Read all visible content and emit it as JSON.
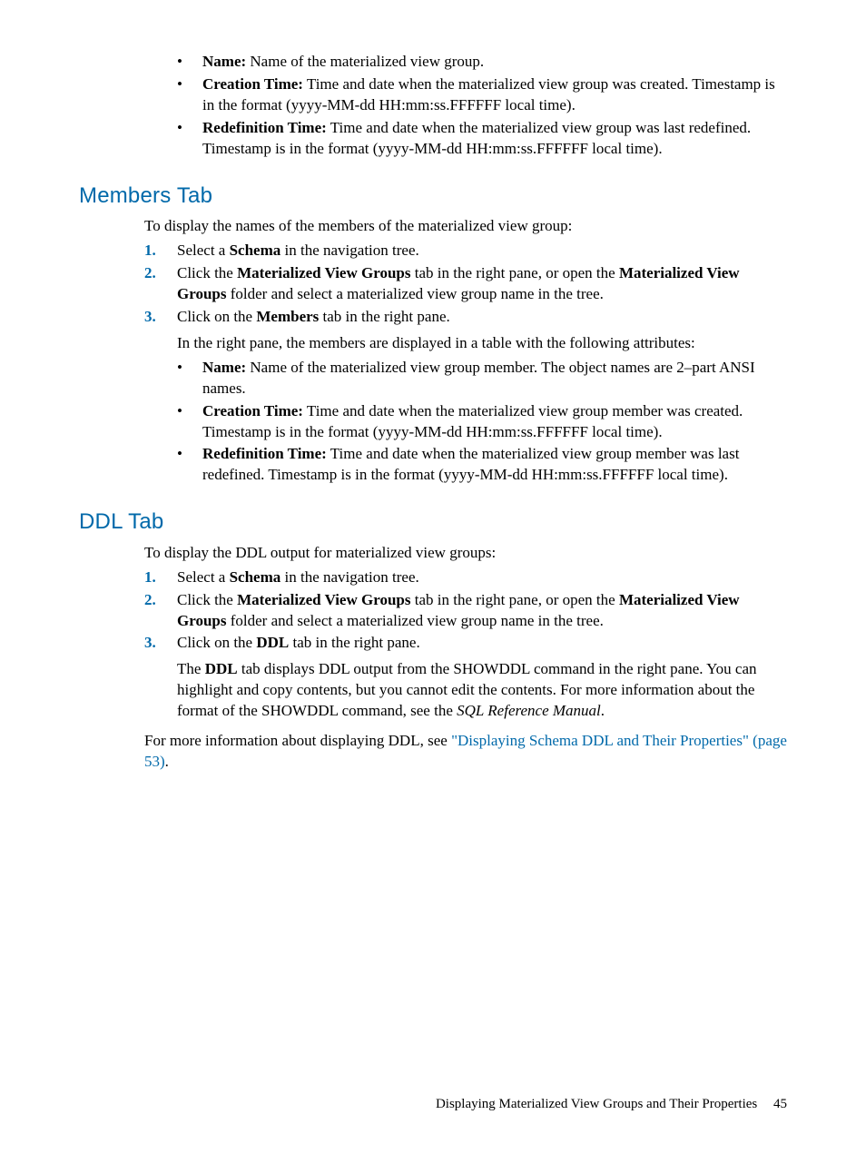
{
  "top_bullets": [
    {
      "label": "Name:",
      "text": " Name of the materialized view group."
    },
    {
      "label": "Creation Time:",
      "text": " Time and date when the materialized view group was created. Timestamp is in the format (yyyy-MM-dd HH:mm:ss.FFFFFF local time)."
    },
    {
      "label": "Redefinition Time:",
      "text": " Time and date when the materialized view group was last redefined. Timestamp is in the format (yyyy-MM-dd HH:mm:ss.FFFFFF local time)."
    }
  ],
  "members": {
    "heading": "Members Tab",
    "intro": "To display the names of the members of the materialized view group:",
    "step1_a": "Select a ",
    "step1_b": "Schema",
    "step1_c": " in the navigation tree.",
    "step2_a": "Click the ",
    "step2_b": "Materialized View Groups",
    "step2_c": " tab in the right pane, or open the ",
    "step2_d": "Materialized View Groups",
    "step2_e": " folder and select a materialized view group name in the tree.",
    "step3_a": "Click on the ",
    "step3_b": "Members",
    "step3_c": " tab in the right pane.",
    "step3_after": "In the right pane, the members are displayed in a table with the following attributes:",
    "bullets": [
      {
        "label": "Name:",
        "text": " Name of the materialized view group member. The object names are 2–part ANSI names."
      },
      {
        "label": "Creation Time:",
        "text": " Time and date when the materialized view group member was created. Timestamp is in the format (yyyy-MM-dd HH:mm:ss.FFFFFF local time)."
      },
      {
        "label": "Redefinition Time:",
        "text": " Time and date when the materialized view group member was last redefined. Timestamp is in the format (yyyy-MM-dd HH:mm:ss.FFFFFF local time)."
      }
    ]
  },
  "ddl": {
    "heading": "DDL Tab",
    "intro": "To display the DDL output for materialized view groups:",
    "step1_a": "Select a ",
    "step1_b": "Schema",
    "step1_c": " in the navigation tree.",
    "step2_a": "Click the ",
    "step2_b": "Materialized View Groups",
    "step2_c": " tab in the right pane, or open the ",
    "step2_d": "Materialized View Groups",
    "step2_e": " folder and select a materialized view group name in the tree.",
    "step3_a": "Click on the ",
    "step3_b": "DDL",
    "step3_c": " tab in the right pane.",
    "step3_after_a": "The ",
    "step3_after_b": "DDL",
    "step3_after_c": " tab displays DDL output from the SHOWDDL command in the right pane. You can highlight and copy contents, but you cannot edit the contents. For more information about the format of the SHOWDDL command, see the ",
    "step3_after_d": "SQL Reference Manual",
    "step3_after_e": ".",
    "closing_a": "For more information about displaying DDL, see ",
    "closing_link": "\"Displaying Schema DDL and Their Properties\" (page 53)",
    "closing_b": "."
  },
  "footer": {
    "title": "Displaying Materialized View Groups and Their Properties",
    "page": "45"
  }
}
